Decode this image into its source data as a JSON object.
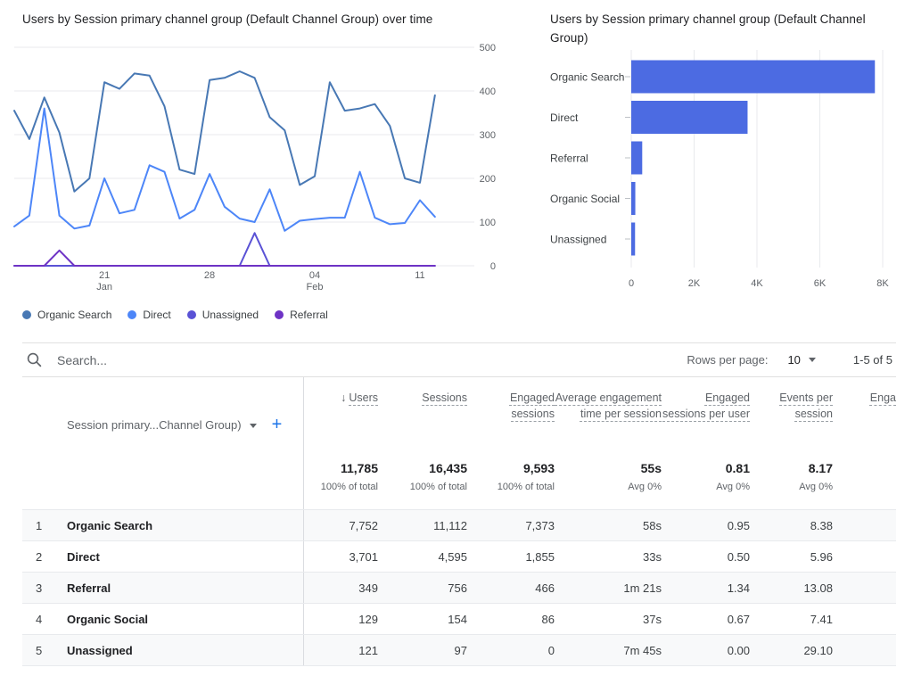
{
  "chart_data": [
    {
      "type": "line",
      "title": "Users by Session primary channel group (Default Channel Group) over time",
      "ylim": [
        0,
        500
      ],
      "y_ticks": [
        0,
        100,
        200,
        300,
        400,
        500
      ],
      "grid": "horizontal",
      "legend_position": "bottom",
      "x": [
        "Jan 15",
        "Jan 16",
        "Jan 17",
        "Jan 18",
        "Jan 19",
        "Jan 20",
        "Jan 21",
        "Jan 22",
        "Jan 23",
        "Jan 24",
        "Jan 25",
        "Jan 26",
        "Jan 27",
        "Jan 28",
        "Jan 29",
        "Jan 30",
        "Jan 31",
        "Feb 01",
        "Feb 02",
        "Feb 03",
        "Feb 04",
        "Feb 05",
        "Feb 06",
        "Feb 07",
        "Feb 08",
        "Feb 09",
        "Feb 10",
        "Feb 11",
        "Feb 12"
      ],
      "x_ticks": [
        {
          "index": 6,
          "label": "21",
          "sub": "Jan"
        },
        {
          "index": 13,
          "label": "28",
          "sub": ""
        },
        {
          "index": 20,
          "label": "04",
          "sub": "Feb"
        },
        {
          "index": 27,
          "label": "11",
          "sub": ""
        }
      ],
      "series": [
        {
          "name": "Organic Search",
          "color": "#4878b4",
          "values": [
            355,
            290,
            385,
            305,
            170,
            200,
            420,
            405,
            440,
            435,
            365,
            220,
            210,
            425,
            430,
            445,
            430,
            340,
            310,
            185,
            205,
            420,
            355,
            360,
            370,
            320,
            200,
            190,
            390
          ]
        },
        {
          "name": "Direct",
          "color": "#4d86f8",
          "values": [
            90,
            115,
            360,
            115,
            85,
            92,
            200,
            120,
            128,
            230,
            215,
            108,
            128,
            210,
            135,
            108,
            100,
            175,
            80,
            103,
            107,
            110,
            110,
            215,
            110,
            95,
            98,
            150,
            112
          ]
        },
        {
          "name": "Unassigned",
          "color": "#5a52d5",
          "values": [
            0,
            0,
            0,
            0,
            0,
            0,
            0,
            0,
            0,
            0,
            0,
            0,
            0,
            0,
            0,
            0,
            75,
            0,
            0,
            0,
            0,
            0,
            0,
            0,
            0,
            0,
            0,
            0,
            0
          ]
        },
        {
          "name": "Referral",
          "color": "#6e33c5",
          "values": [
            0,
            0,
            0,
            35,
            0,
            0,
            0,
            0,
            0,
            0,
            0,
            0,
            0,
            0,
            0,
            0,
            0,
            0,
            0,
            0,
            0,
            0,
            0,
            0,
            0,
            0,
            0,
            0,
            0
          ]
        }
      ]
    },
    {
      "type": "bar",
      "orientation": "horizontal",
      "title": "Users by Session primary channel group (Default Channel Group)",
      "categories": [
        "Organic Search",
        "Direct",
        "Referral",
        "Organic Social",
        "Unassigned"
      ],
      "values": [
        7752,
        3701,
        349,
        129,
        121
      ],
      "xlim": [
        0,
        8000
      ],
      "x_ticks": [
        "0",
        "2K",
        "4K",
        "6K",
        "8K"
      ],
      "bar_color": "#4c6be2",
      "grid": "vertical"
    }
  ],
  "toolbar": {
    "search_placeholder": "Search...",
    "rows_per_page_label": "Rows per page:",
    "rows_per_page_value": "10",
    "pagination": "1-5 of 5"
  },
  "table": {
    "dimension_header": "Session primary...Channel Group)",
    "add_label": "+",
    "sort_icon": "↓",
    "columns": [
      "Users",
      "Sessions",
      "Engaged sessions",
      "Average engagement time per session",
      "Engaged sessions per user",
      "Events per session",
      "Enga"
    ],
    "totals": [
      {
        "value": "11,785",
        "sub": "100% of total"
      },
      {
        "value": "16,435",
        "sub": "100% of total"
      },
      {
        "value": "9,593",
        "sub": "100% of total"
      },
      {
        "value": "55s",
        "sub": "Avg 0%"
      },
      {
        "value": "0.81",
        "sub": "Avg 0%"
      },
      {
        "value": "8.17",
        "sub": "Avg 0%"
      }
    ],
    "rows": [
      {
        "num": "1",
        "channel": "Organic Search",
        "values": [
          "7,752",
          "11,112",
          "7,373",
          "58s",
          "0.95",
          "8.38"
        ]
      },
      {
        "num": "2",
        "channel": "Direct",
        "values": [
          "3,701",
          "4,595",
          "1,855",
          "33s",
          "0.50",
          "5.96"
        ]
      },
      {
        "num": "3",
        "channel": "Referral",
        "values": [
          "349",
          "756",
          "466",
          "1m 21s",
          "1.34",
          "13.08"
        ]
      },
      {
        "num": "4",
        "channel": "Organic Social",
        "values": [
          "129",
          "154",
          "86",
          "37s",
          "0.67",
          "7.41"
        ]
      },
      {
        "num": "5",
        "channel": "Unassigned",
        "values": [
          "121",
          "97",
          "0",
          "7m 45s",
          "0.00",
          "29.10"
        ]
      }
    ]
  }
}
